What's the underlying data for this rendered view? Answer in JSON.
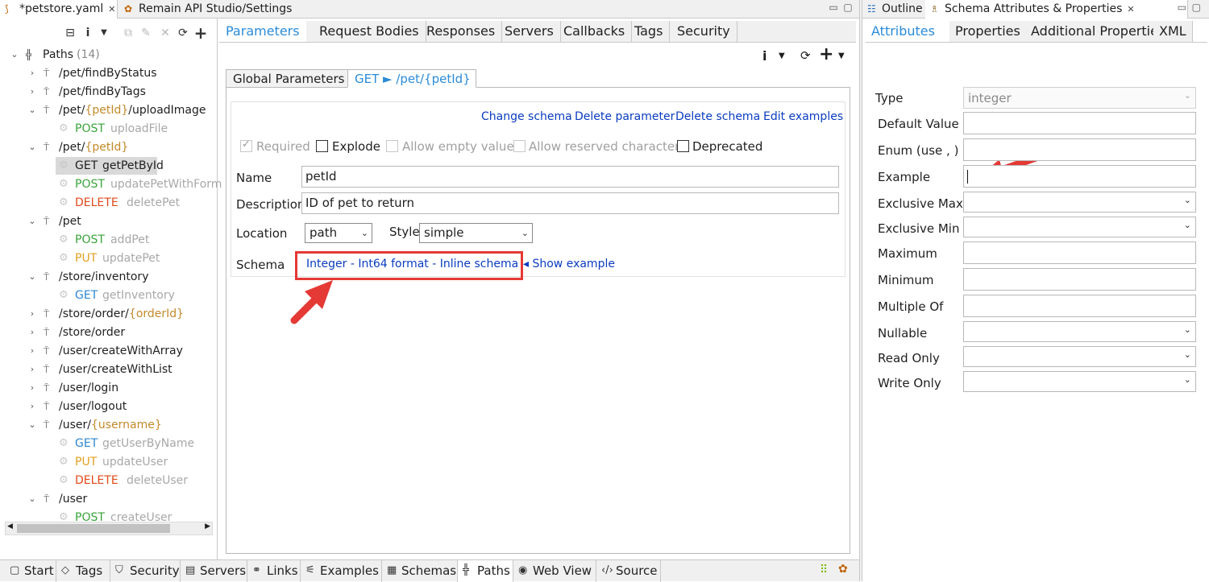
{
  "editor_tabs": [
    {
      "label": "*petstore.yaml",
      "active": true
    },
    {
      "label": "Remain API Studio/Settings",
      "active": false
    }
  ],
  "outline": {
    "root_label": "Paths",
    "root_count": "(14)",
    "rows": [
      {
        "kind": "path",
        "expanded": false,
        "text": "/pet/findByStatus"
      },
      {
        "kind": "path",
        "expanded": false,
        "text": "/pet/findByTags"
      },
      {
        "kind": "path",
        "expanded": true,
        "pre": "/pet/",
        "param": "{petId}",
        "post": "/uploadImage"
      },
      {
        "kind": "op",
        "method": "POST",
        "id": "uploadFile"
      },
      {
        "kind": "path",
        "expanded": true,
        "pre": "/pet/",
        "param": "{petId}",
        "post": ""
      },
      {
        "kind": "op",
        "method": "GET",
        "id": "getPetById",
        "selected": true
      },
      {
        "kind": "op",
        "method": "POST",
        "id": "updatePetWithForm"
      },
      {
        "kind": "op",
        "method": "DELETE",
        "id": "deletePet"
      },
      {
        "kind": "path",
        "expanded": true,
        "text": "/pet"
      },
      {
        "kind": "op",
        "method": "POST",
        "id": "addPet"
      },
      {
        "kind": "op",
        "method": "PUT",
        "id": "updatePet"
      },
      {
        "kind": "path",
        "expanded": true,
        "text": "/store/inventory"
      },
      {
        "kind": "op",
        "method": "GET",
        "id": "getInventory"
      },
      {
        "kind": "path",
        "expanded": false,
        "pre": "/store/order/",
        "param": "{orderId}",
        "post": ""
      },
      {
        "kind": "path",
        "expanded": false,
        "text": "/store/order"
      },
      {
        "kind": "path",
        "expanded": false,
        "text": "/user/createWithArray"
      },
      {
        "kind": "path",
        "expanded": false,
        "text": "/user/createWithList"
      },
      {
        "kind": "path",
        "expanded": false,
        "text": "/user/login"
      },
      {
        "kind": "path",
        "expanded": false,
        "text": "/user/logout"
      },
      {
        "kind": "path",
        "expanded": true,
        "pre": "/user/",
        "param": "{username}",
        "post": ""
      },
      {
        "kind": "op",
        "method": "GET",
        "id": "getUserByName"
      },
      {
        "kind": "op",
        "method": "PUT",
        "id": "updateUser"
      },
      {
        "kind": "op",
        "method": "DELETE",
        "id": "deleteUser"
      },
      {
        "kind": "path",
        "expanded": true,
        "text": "/user"
      },
      {
        "kind": "op",
        "method": "POST",
        "id": "createUser"
      }
    ]
  },
  "center_tabs": [
    "Parameters",
    "Request Bodies",
    "Responses",
    "Servers",
    "Callbacks",
    "Tags",
    "Security"
  ],
  "inner_tabs": {
    "global": "Global Parameters",
    "operation": "GET ► /pet/{petId}"
  },
  "param_actions": [
    "Change schema",
    "Delete parameter",
    "Delete schema",
    "Edit examples"
  ],
  "param_flags": [
    {
      "label": "Required",
      "checked": true,
      "enabled": false
    },
    {
      "label": "Explode",
      "checked": false,
      "enabled": true
    },
    {
      "label": "Allow empty value",
      "checked": false,
      "enabled": false
    },
    {
      "label": "Allow reserved characters",
      "checked": false,
      "enabled": false
    },
    {
      "label": "Deprecated",
      "checked": false,
      "enabled": true
    }
  ],
  "param_form": {
    "name_label": "Name",
    "name_value": "petId",
    "description_label": "Description",
    "description_value": "ID of pet to return",
    "location_label": "Location",
    "location_value": "path",
    "style_label": "Style",
    "style_value": "simple",
    "schema_label": "Schema",
    "schema_parts": [
      "Integer",
      "Int64 format",
      "Inline schema"
    ],
    "schema_sep": " - ",
    "show_example": "◂ Show example"
  },
  "right_view_tabs": [
    {
      "label": "Outline",
      "active": false
    },
    {
      "label": "Schema Attributes & Properties",
      "active": true
    }
  ],
  "right_tabs": [
    "Attributes",
    "Properties",
    "Additional Propertie",
    "XML"
  ],
  "attributes": {
    "type_label": "Type",
    "type_value": "integer",
    "fields": [
      {
        "label": "Default Value",
        "widget": "text"
      },
      {
        "label": "Enum (use , )",
        "widget": "text"
      },
      {
        "label": "Example",
        "widget": "text",
        "focused": true
      },
      {
        "label": "Exclusive Max",
        "widget": "combo"
      },
      {
        "label": "Exclusive Min",
        "widget": "combo"
      },
      {
        "label": "Maximum",
        "widget": "text"
      },
      {
        "label": "Minimum",
        "widget": "text"
      },
      {
        "label": "Multiple Of",
        "widget": "text"
      },
      {
        "label": "Nullable",
        "widget": "combo"
      },
      {
        "label": "Read Only",
        "widget": "combo"
      },
      {
        "label": "Write Only",
        "widget": "combo"
      }
    ]
  },
  "bottom_tabs": [
    {
      "label": "Start",
      "icon": "▢"
    },
    {
      "label": "Tags",
      "icon": "◇"
    },
    {
      "label": "Security",
      "icon": "⛉"
    },
    {
      "label": "Servers",
      "icon": "▤"
    },
    {
      "label": "Links",
      "icon": "⚭"
    },
    {
      "label": "Examples",
      "icon": "⚟"
    },
    {
      "label": "Schemas",
      "icon": "▦"
    },
    {
      "label": "Paths",
      "icon": "╬",
      "active": true
    },
    {
      "label": "Web View",
      "icon": "◉"
    },
    {
      "label": "Source",
      "icon": "‹/›"
    }
  ],
  "colors": {
    "accent": "#2a8bd8",
    "link": "#0a3cbf",
    "highlight": "#e53935",
    "get": "#2e86d0",
    "post": "#3aa33a",
    "put": "#e0a020",
    "delete": "#e04a1a"
  }
}
